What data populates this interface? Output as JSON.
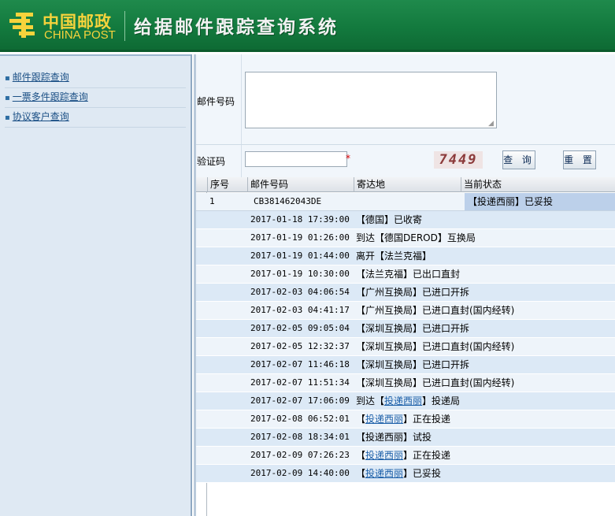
{
  "header": {
    "logo_cn": "中国邮政",
    "logo_en": "CHINA POST",
    "title": "给据邮件跟踪查询系统"
  },
  "sidebar": {
    "items": [
      {
        "label": "邮件跟踪查询"
      },
      {
        "label": "一票多件跟踪查询"
      },
      {
        "label": "协议客户查询"
      }
    ]
  },
  "form": {
    "mail_label": "邮件号码",
    "mail_value": "",
    "captcha_label": "验证码",
    "captcha_value": "",
    "required_mark": "*",
    "captcha_text": "7449",
    "query_button": "查 询",
    "reset_button": "重 置"
  },
  "table": {
    "headers": {
      "no": "序号",
      "mail": "邮件号码",
      "dest": "寄达地",
      "status": "当前状态"
    },
    "main_row": {
      "no": "1",
      "mail": "CB381462043DE",
      "status": "【投递西丽】已妥投"
    },
    "events": [
      {
        "time": "2017-01-18 17:39:00",
        "pre": "【德国】已收寄",
        "link": "",
        "post": ""
      },
      {
        "time": "2017-01-19 01:26:00",
        "pre": "到达【德国DEROD】互换局",
        "link": "",
        "post": ""
      },
      {
        "time": "2017-01-19 01:44:00",
        "pre": "离开【法兰克福】",
        "link": "",
        "post": ""
      },
      {
        "time": "2017-01-19 10:30:00",
        "pre": "【法兰克福】已出口直封",
        "link": "",
        "post": ""
      },
      {
        "time": "2017-02-03 04:06:54",
        "pre": "【广州互换局】已进口开拆",
        "link": "",
        "post": ""
      },
      {
        "time": "2017-02-03 04:41:17",
        "pre": "【广州互换局】已进口直封(国内经转)",
        "link": "",
        "post": ""
      },
      {
        "time": "2017-02-05 09:05:04",
        "pre": "【深圳互换局】已进口开拆",
        "link": "",
        "post": ""
      },
      {
        "time": "2017-02-05 12:32:37",
        "pre": "【深圳互换局】已进口直封(国内经转)",
        "link": "",
        "post": ""
      },
      {
        "time": "2017-02-07 11:46:18",
        "pre": "【深圳互换局】已进口开拆",
        "link": "",
        "post": ""
      },
      {
        "time": "2017-02-07 11:51:34",
        "pre": "【深圳互换局】已进口直封(国内经转)",
        "link": "",
        "post": ""
      },
      {
        "time": "2017-02-07 17:06:09",
        "pre": "到达【",
        "link": "投递西丽",
        "post": "】投递局"
      },
      {
        "time": "2017-02-08 06:52:01",
        "pre": "【",
        "link": "投递西丽",
        "post": "】正在投递"
      },
      {
        "time": "2017-02-08 18:34:01",
        "pre": "【投递西丽】试投",
        "link": "",
        "post": ""
      },
      {
        "time": "2017-02-09 07:26:23",
        "pre": "【",
        "link": "投递西丽",
        "post": "】正在投递"
      },
      {
        "time": "2017-02-09 14:40:00",
        "pre": "【",
        "link": "投递西丽",
        "post": "】已妥投"
      }
    ]
  },
  "colors": {
    "header_green": "#137a3e",
    "logo_yellow": "#f6d33c",
    "sidebar_bg": "#dfe9f3",
    "link_blue": "#1a5ea8"
  }
}
